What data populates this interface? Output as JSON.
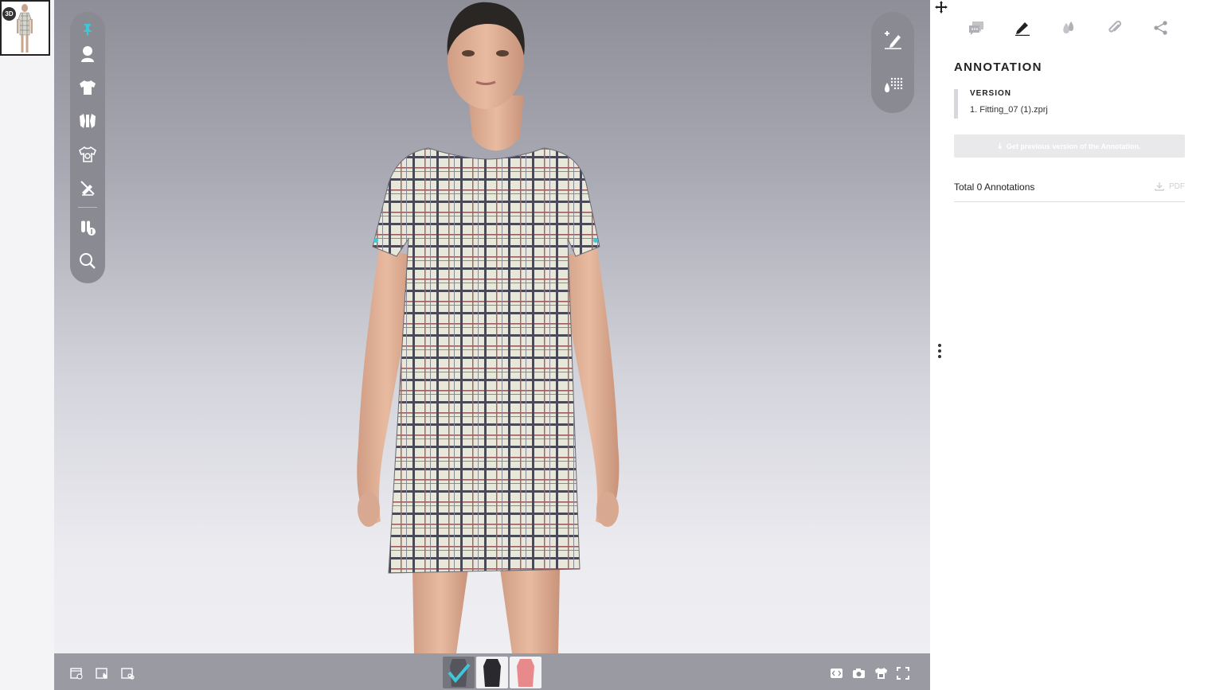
{
  "thumbnail": {
    "badge": "3D"
  },
  "left_toolbar": {
    "items": [
      "pin-icon",
      "avatar-icon",
      "garment-icon",
      "fabric-icon",
      "colorway-icon",
      "hide-avatar-icon",
      "measure-icon",
      "zoom-icon"
    ],
    "accent": "#3ec7d8"
  },
  "right_toolbar": {
    "items": [
      "add-annotation-icon",
      "texture-grid-icon"
    ]
  },
  "bottom_bar": {
    "left_buttons": [
      "view-settings-icon",
      "snapshot-view-icon",
      "render-view-icon"
    ],
    "colorways": [
      {
        "name": "colorway-check",
        "color": "#6a6a72",
        "selected": true
      },
      {
        "name": "colorway-black",
        "color": "#2a2a2e",
        "selected": false
      },
      {
        "name": "colorway-pink",
        "color": "#e88a8c",
        "selected": false
      }
    ],
    "right_buttons": [
      "embed-code-icon",
      "camera-icon",
      "avatar-export-icon",
      "fullscreen-icon"
    ]
  },
  "panel": {
    "tabs": [
      "comments-icon",
      "annotation-icon",
      "colors-icon",
      "attachment-icon",
      "share-icon"
    ],
    "active_tab": "annotation-icon",
    "title": "ANNOTATION",
    "version_label": "VERSION",
    "version_value": "1. Fitting_07 (1).zprj",
    "prev_button": "Get previous version of the Annotation.",
    "total_text": "Total 0 Annotations",
    "pdf_label": "PDF"
  }
}
